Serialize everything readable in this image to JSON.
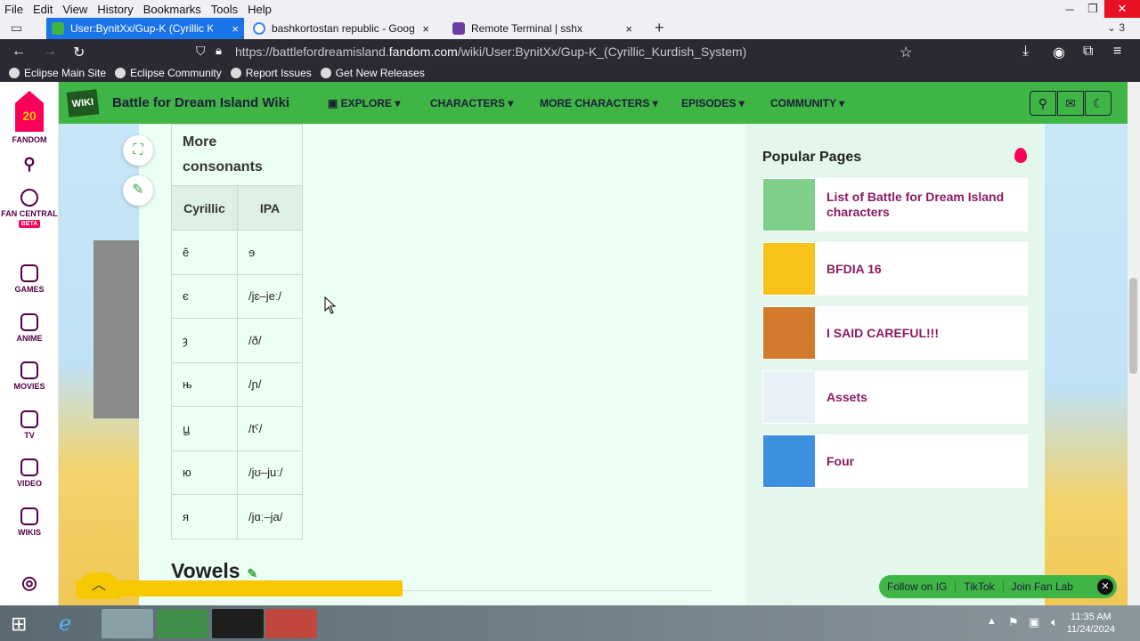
{
  "menubar": {
    "items": [
      "File",
      "Edit",
      "View",
      "History",
      "Bookmarks",
      "Tools",
      "Help"
    ]
  },
  "tabs": [
    {
      "title": "User:BynitXx/Gup-K (Cyrillic Kur",
      "close": "×"
    },
    {
      "title": "bashkortostan republic - Google",
      "close": "×"
    },
    {
      "title": "Remote Terminal | sshx",
      "close": "×"
    }
  ],
  "tab_overflow_count": "3",
  "url": {
    "prefix": "https://battlefordreamisland.",
    "domain": "fandom.com",
    "path": "/wiki/User:BynitXx/Gup-K_(Cyrillic_Kurdish_System)"
  },
  "bookmarks": [
    "Eclipse Main Site",
    "Eclipse Community",
    "Report Issues",
    "Get New Releases"
  ],
  "rail": {
    "fandom": "FANDOM",
    "fandom_badge": "20",
    "items": [
      "FAN CENTRAL",
      "GAMES",
      "ANIME",
      "MOVIES",
      "TV",
      "VIDEO",
      "WIKIS"
    ],
    "beta": "BETA"
  },
  "wiki": {
    "logo": "WIKI",
    "title": "Battle for Dream Island Wiki",
    "nav": [
      "EXPLORE",
      "CHARACTERS",
      "MORE CHARACTERS",
      "EPISODES",
      "COMMUNITY"
    ]
  },
  "table": {
    "caption": "More consonants",
    "headers": [
      "Cyrillic",
      "IPA"
    ],
    "rows": [
      [
        "ӗ",
        "ɘ"
      ],
      [
        "є",
        "/jɛ–jeː/"
      ],
      [
        "ȝ",
        "/ð/"
      ],
      [
        "њ",
        "/ɲ/"
      ],
      [
        "ꚏ",
        "/tˤ/"
      ],
      [
        "ю",
        "/jʊ–juː/"
      ],
      [
        "я",
        "/jɑː–ja/"
      ]
    ]
  },
  "section_heading": "Vowels",
  "popular": {
    "title": "Popular Pages",
    "items": [
      {
        "label": "List of Battle for Dream Island characters",
        "thumb_color": "#7fcf8a"
      },
      {
        "label": "BFDIA 16",
        "thumb_color": "#f7c21a"
      },
      {
        "label": "I SAID CAREFUL!!!",
        "thumb_color": "#d27a2c"
      },
      {
        "label": "Assets",
        "thumb_color": "#e8f0f8"
      },
      {
        "label": "Four",
        "thumb_color": "#3d8fe0"
      }
    ]
  },
  "social": [
    "Follow on IG",
    "TikTok",
    "Join Fan Lab"
  ],
  "clock": {
    "time": "11:35 AM",
    "date": "11/24/2024"
  },
  "colors": {
    "fandom_green": "#3eb544",
    "link": "#8b1b63",
    "fandom_pink": "#fa005a",
    "accent_tab": "#1a73e8"
  }
}
